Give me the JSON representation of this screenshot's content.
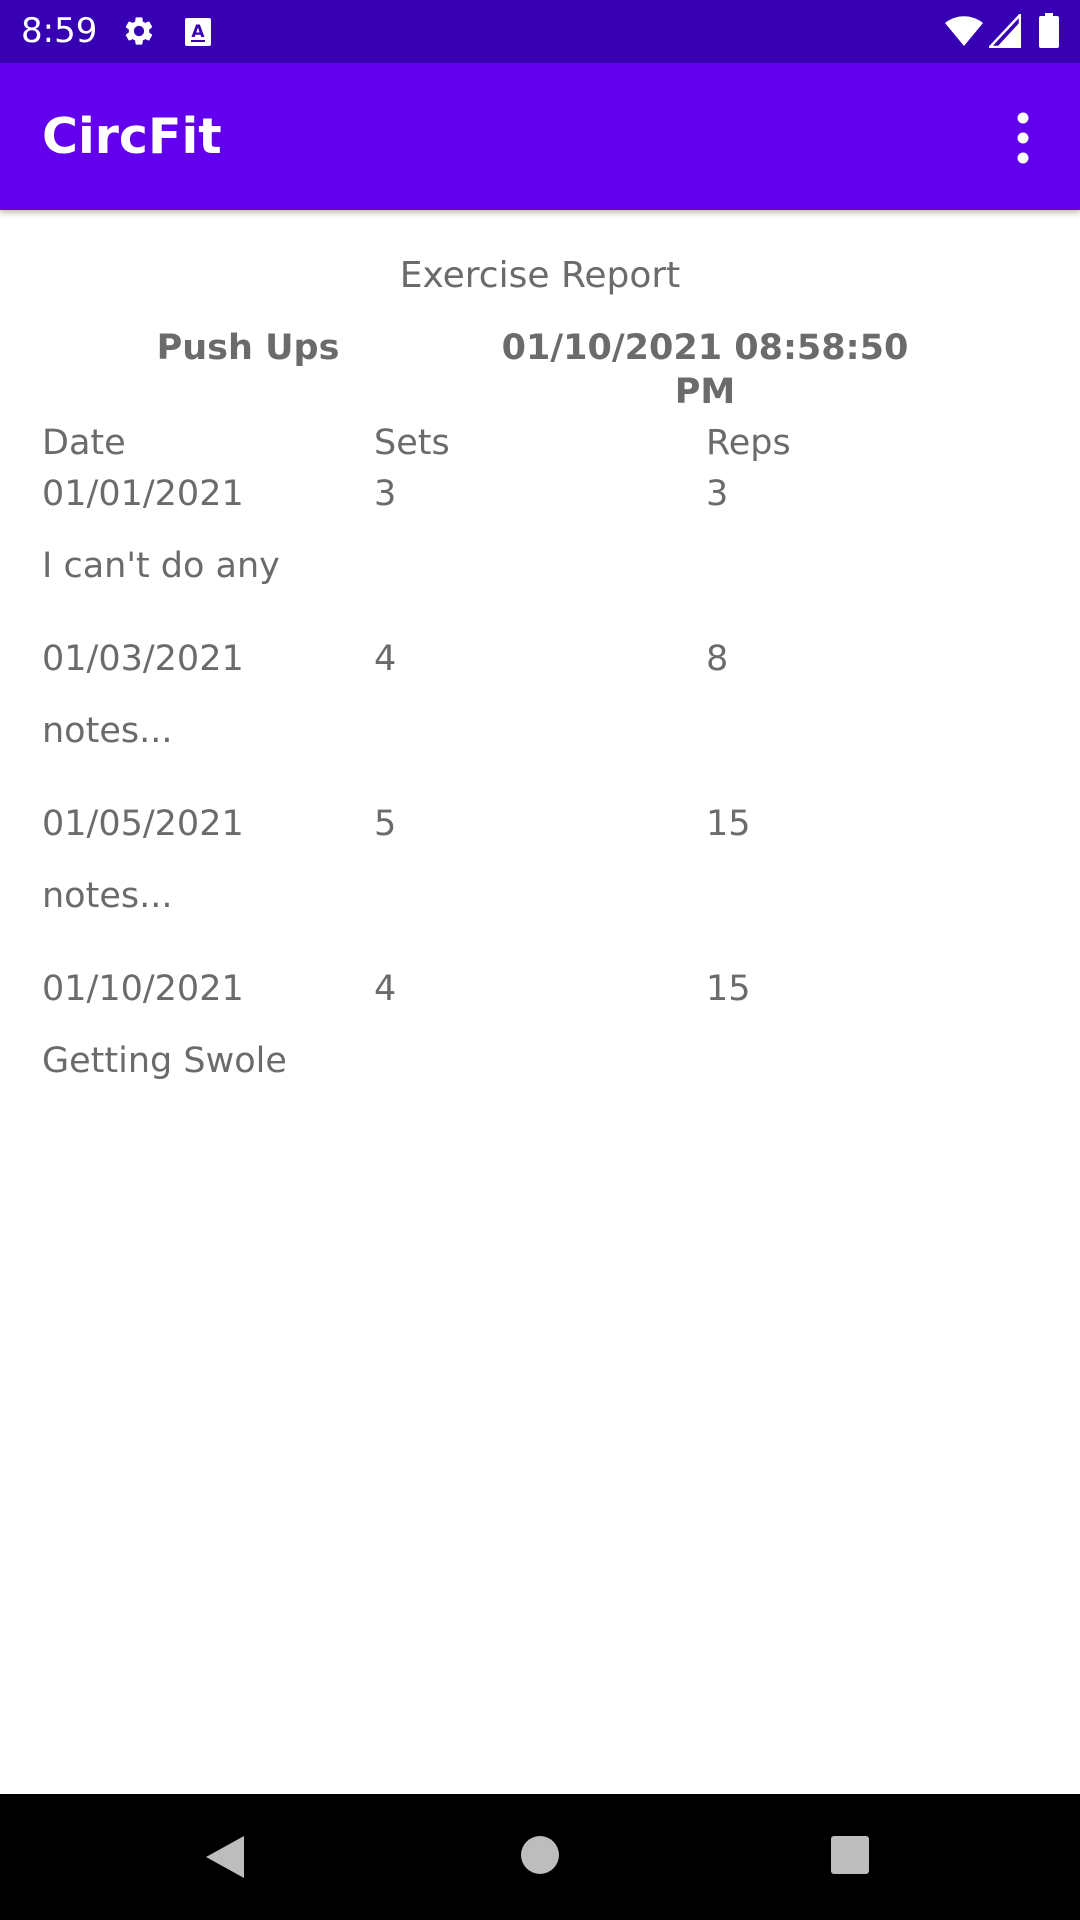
{
  "status_bar": {
    "time": "8:59",
    "icons": [
      "gear-icon",
      "keyboard-a-icon",
      "wifi-icon",
      "cell-signal-icon",
      "battery-icon"
    ]
  },
  "app_bar": {
    "title": "CircFit",
    "menu_icon": "more-vert-icon",
    "color": "#6200ee",
    "status_color": "#3700b3"
  },
  "report": {
    "title": "Exercise Report",
    "exercise_name": "Push Ups",
    "datetime": "01/10/2021 08:58:50 PM",
    "columns": {
      "date": "Date",
      "sets": "Sets",
      "reps": "Reps"
    },
    "entries": [
      {
        "date": "01/01/2021",
        "sets": "3",
        "reps": "3",
        "notes": "I can't do any"
      },
      {
        "date": "01/03/2021",
        "sets": "4",
        "reps": "8",
        "notes": "notes..."
      },
      {
        "date": "01/05/2021",
        "sets": "5",
        "reps": "15",
        "notes": "notes..."
      },
      {
        "date": "01/10/2021",
        "sets": "4",
        "reps": "15",
        "notes": "Getting Swole"
      }
    ]
  },
  "nav_bar": {
    "buttons": [
      "back-icon",
      "home-icon",
      "recents-icon"
    ]
  }
}
